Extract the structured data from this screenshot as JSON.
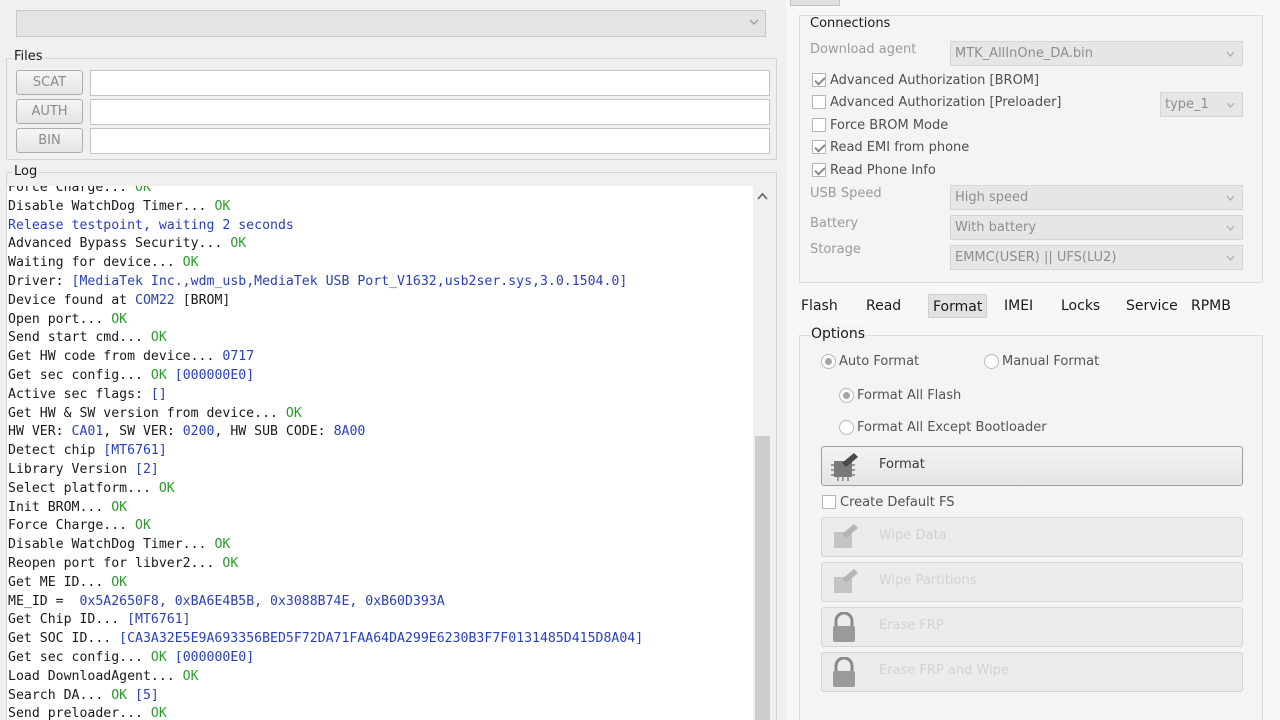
{
  "files": {
    "title": "Files",
    "buttons": [
      {
        "label": "SCAT",
        "value": ""
      },
      {
        "label": "AUTH",
        "value": ""
      },
      {
        "label": "BIN",
        "value": ""
      }
    ]
  },
  "log": {
    "title": "Log",
    "lines": [
      [
        [
          "Force Charge... ",
          "plain"
        ],
        [
          "OK",
          "ok"
        ]
      ],
      [
        [
          "Disable WatchDog Timer... ",
          "plain"
        ],
        [
          "OK",
          "ok"
        ]
      ],
      [
        [
          "Release testpoint, waiting 2 seconds",
          "info"
        ]
      ],
      [
        [
          "Advanced Bypass Security... ",
          "plain"
        ],
        [
          "OK",
          "ok"
        ]
      ],
      [
        [
          "Waiting for device... ",
          "plain"
        ],
        [
          "OK",
          "ok"
        ]
      ],
      [
        [
          "Driver: ",
          "plain"
        ],
        [
          "[MediaTek Inc.,wdm_usb,MediaTek USB Port_V1632,usb2ser.sys,3.0.1504.0]",
          "info"
        ]
      ],
      [
        [
          "Device found at ",
          "plain"
        ],
        [
          "COM22",
          "info"
        ],
        [
          " [BROM]",
          "plain"
        ]
      ],
      [
        [
          "Open port... ",
          "plain"
        ],
        [
          "OK",
          "ok"
        ]
      ],
      [
        [
          "Send start cmd... ",
          "plain"
        ],
        [
          "OK",
          "ok"
        ]
      ],
      [
        [
          "Get HW code from device... ",
          "plain"
        ],
        [
          "0717",
          "info"
        ]
      ],
      [
        [
          "Get sec config... ",
          "plain"
        ],
        [
          "OK",
          "ok"
        ],
        [
          " [000000E0]",
          "info"
        ]
      ],
      [
        [
          "Active sec flags: ",
          "plain"
        ],
        [
          "[]",
          "info"
        ]
      ],
      [
        [
          "Get HW & SW version from device... ",
          "plain"
        ],
        [
          "OK",
          "ok"
        ]
      ],
      [
        [
          "HW VER: ",
          "plain"
        ],
        [
          "CA01",
          "info"
        ],
        [
          ", SW VER: ",
          "plain"
        ],
        [
          "0200",
          "info"
        ],
        [
          ", HW SUB CODE: ",
          "plain"
        ],
        [
          "8A00",
          "info"
        ]
      ],
      [
        [
          "Detect chip ",
          "plain"
        ],
        [
          "[MT6761]",
          "info"
        ]
      ],
      [
        [
          "Library Version ",
          "plain"
        ],
        [
          "[2]",
          "info"
        ]
      ],
      [
        [
          "Select platform... ",
          "plain"
        ],
        [
          "OK",
          "ok"
        ]
      ],
      [
        [
          "Init BROM... ",
          "plain"
        ],
        [
          "OK",
          "ok"
        ]
      ],
      [
        [
          "Force Charge... ",
          "plain"
        ],
        [
          "OK",
          "ok"
        ]
      ],
      [
        [
          "Disable WatchDog Timer... ",
          "plain"
        ],
        [
          "OK",
          "ok"
        ]
      ],
      [
        [
          "Reopen port for libver2... ",
          "plain"
        ],
        [
          "OK",
          "ok"
        ]
      ],
      [
        [
          "Get ME ID... ",
          "plain"
        ],
        [
          "OK",
          "ok"
        ]
      ],
      [
        [
          "ME_ID =  ",
          "plain"
        ],
        [
          "0x5A2650F8, 0xBA6E4B5B, 0x3088B74E, 0xB60D393A",
          "info"
        ]
      ],
      [
        [
          "Get Chip ID... ",
          "plain"
        ],
        [
          "[MT6761]",
          "info"
        ]
      ],
      [
        [
          "Get SOC ID... ",
          "plain"
        ],
        [
          "[CA3A32E5E9A693356BED5F72DA71FAA64DA299E6230B3F7F0131485D415D8A04]",
          "info"
        ]
      ],
      [
        [
          "Get sec config... ",
          "plain"
        ],
        [
          "OK",
          "ok"
        ],
        [
          " [000000E0]",
          "info"
        ]
      ],
      [
        [
          "Load DownloadAgent... ",
          "plain"
        ],
        [
          "OK",
          "ok"
        ]
      ],
      [
        [
          "Search DA... ",
          "plain"
        ],
        [
          "OK",
          "ok"
        ],
        [
          " [5]",
          "info"
        ]
      ],
      [
        [
          "Send preloader... ",
          "plain"
        ],
        [
          "OK",
          "ok"
        ]
      ]
    ]
  },
  "connections": {
    "title": "Connections",
    "download_agent_label": "Download agent",
    "download_agent_value": "MTK_AllInOne_DA.bin",
    "checkboxes": [
      {
        "label": "Advanced Authorization [BROM]",
        "checked": true
      },
      {
        "label": "Advanced Authorization [Preloader]",
        "checked": false
      },
      {
        "label": "Force BROM Mode",
        "checked": false
      },
      {
        "label": "Read EMI from phone",
        "checked": true
      },
      {
        "label": "Read Phone Info",
        "checked": true
      }
    ],
    "preloader_type": "type_1",
    "usb_speed_label": "USB Speed",
    "usb_speed_value": "High speed",
    "battery_label": "Battery",
    "battery_value": "With battery",
    "storage_label": "Storage",
    "storage_value": "EMMC(USER) || UFS(LU2)"
  },
  "tabs": [
    "Flash",
    "Read",
    "Format",
    "IMEI",
    "Locks",
    "Service",
    "RPMB"
  ],
  "active_tab": "Format",
  "options": {
    "title": "Options",
    "auto_format": "Auto Format",
    "manual_format": "Manual Format",
    "format_all_flash": "Format All Flash",
    "format_all_except": "Format All Except Bootloader",
    "format_button": "Format",
    "create_default_fs": "Create Default FS",
    "wipe_data": "Wipe Data",
    "wipe_partitions": "Wipe Partitions",
    "erase_frp": "Erase FRP",
    "erase_frp_wipe": "Erase FRP and Wipe"
  },
  "colors": {
    "ok": "#2e9a2e",
    "info": "#2a40b8"
  }
}
